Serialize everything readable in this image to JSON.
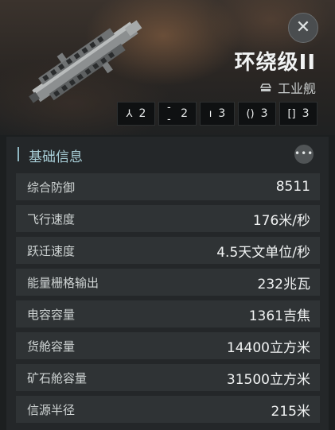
{
  "ship": {
    "name": "环绕级II",
    "class_label": "工业舰",
    "class_icon": "industrial-ship-icon",
    "close_icon": "close-icon"
  },
  "slots": [
    {
      "icon": "high-slot-icon",
      "glyph": "⅄",
      "count": "2"
    },
    {
      "icon": "mid-slot-icon",
      "glyph": "--",
      "count": "2"
    },
    {
      "icon": "low-slot-icon",
      "glyph": "ı",
      "count": "3"
    },
    {
      "icon": "rig-slot-icon",
      "glyph": "()",
      "count": "3"
    },
    {
      "icon": "subsystem-slot-icon",
      "glyph": "[]",
      "count": "3"
    }
  ],
  "section": {
    "title": "基础信息",
    "more_icon": "more-icon"
  },
  "attributes": [
    {
      "label": "综合防御",
      "value": "8511"
    },
    {
      "label": "飞行速度",
      "value": "176米/秒"
    },
    {
      "label": "跃迁速度",
      "value": "4.5天文单位/秒"
    },
    {
      "label": "能量栅格输出",
      "value": "232兆瓦"
    },
    {
      "label": "电容容量",
      "value": "1361吉焦"
    },
    {
      "label": "货舱容量",
      "value": "14400立方米"
    },
    {
      "label": "矿石舱容量",
      "value": "31500立方米"
    },
    {
      "label": "信源半径",
      "value": "215米"
    }
  ],
  "colors": {
    "background": "#1c1f20",
    "accent": "#a9cfd8",
    "row": "#2f3335"
  }
}
